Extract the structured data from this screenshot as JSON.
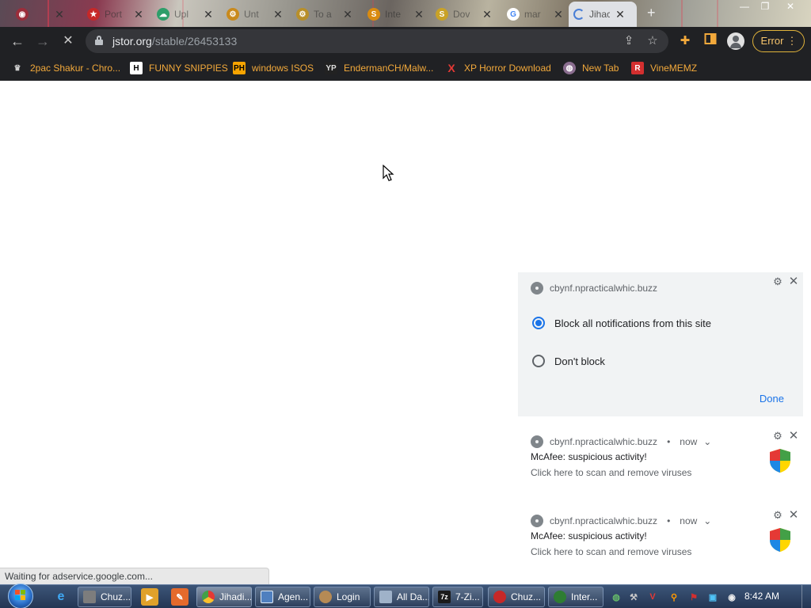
{
  "browser": {
    "tabs": [
      {
        "label": "",
        "icon": "red-globe-icon"
      },
      {
        "label": "Port",
        "icon": "red-star-icon"
      },
      {
        "label": "Upl",
        "icon": "green-cloud-icon"
      },
      {
        "label": "Unt",
        "icon": "orange-gear-icon"
      },
      {
        "label": "To a",
        "icon": "gold-gear-icon"
      },
      {
        "label": "Inte",
        "icon": "orange-s-icon"
      },
      {
        "label": "",
        "icon": "black-page-icon"
      },
      {
        "label": "Dov",
        "icon": "gold-s-icon"
      },
      {
        "label": "mar",
        "icon": "google-g-icon"
      },
      {
        "label": "Jihac",
        "icon": "loading-spinner-icon",
        "active": true
      }
    ],
    "url_host": "jstor.org",
    "url_path": "/stable/26453133",
    "error_label": "Error",
    "bookmarks": [
      {
        "label": "2pac Shakur - Chro...",
        "icon": "crown-icon"
      },
      {
        "label": "FUNNY SNIPPIES",
        "icon": "h-letter-icon"
      },
      {
        "label": "windows ISOS",
        "icon": "ph-icon"
      },
      {
        "label": "EndermanCH/Malw...",
        "icon": "yp-icon"
      },
      {
        "label": "XP Horror Download",
        "icon": "red-x-icon"
      },
      {
        "label": "New Tab",
        "icon": "globe-icon"
      },
      {
        "label": "VineMEMZ",
        "icon": "r-letter-icon"
      }
    ],
    "status": "Waiting for adservice.google.com..."
  },
  "notification_permission": {
    "site": "cbynf.npracticalwhic.buzz",
    "option_block": "Block all notifications from this site",
    "option_allow": "Don't block",
    "selected": "block",
    "done_label": "Done"
  },
  "notifications": [
    {
      "site": "cbynf.npracticalwhic.buzz",
      "time": "now",
      "title": "McAfee: suspicious activity!",
      "body": "Click here to scan and remove viruses"
    },
    {
      "site": "cbynf.npracticalwhic.buzz",
      "time": "now",
      "title": "McAfee: suspicious activity!",
      "body": "Click here to scan and remove viruses"
    }
  ],
  "taskbar": {
    "windows": [
      {
        "label": "Chuz...",
        "icon": "gray-window-icon"
      },
      {
        "label": "Jihadi...",
        "icon": "chrome-icon",
        "active": true
      },
      {
        "label": "Agen...",
        "icon": "window-icon"
      },
      {
        "label": "Login",
        "icon": "user-icon"
      },
      {
        "label": "All Da...",
        "icon": "folder-icon"
      },
      {
        "label": "7-Zi...",
        "icon": "sevenzip-icon"
      },
      {
        "label": "Chuz...",
        "icon": "red-app-icon"
      },
      {
        "label": "Inter...",
        "icon": "globe-icon"
      }
    ],
    "clock": "8:42 AM"
  },
  "colors": {
    "chrome_dark": "#202124",
    "omnibox": "#35363a",
    "bookmark_text": "#f2a93b",
    "error_text": "#f7c46c",
    "accent_blue": "#1a73e8"
  }
}
